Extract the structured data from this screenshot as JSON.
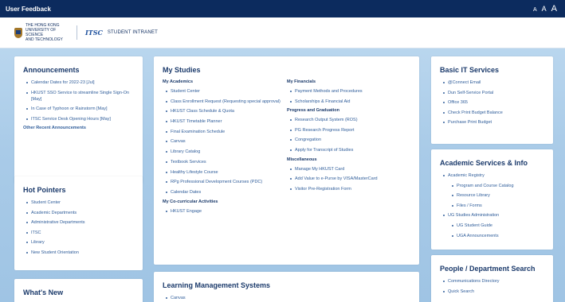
{
  "topbar": {
    "feedback": "User Feedback",
    "font_sizes": [
      "A",
      "A",
      "A"
    ]
  },
  "header": {
    "university_lines": [
      "THE HONG KONG",
      "UNIVERSITY OF SCIENCE",
      "AND TECHNOLOGY"
    ],
    "itsc_logo": "ITSC",
    "portal_name": "STUDENT INTRANET"
  },
  "announcements": {
    "title": "Announcements",
    "items": [
      "Calendar Dates for 2022-23 [Jul]",
      "HKUST SSO Service to streamline Single Sign-On [May]",
      "In Case of Typhoon or Rainstorm [May]",
      "ITSC Service Desk Opening Hours [May]"
    ],
    "other": "Other Recent Announcements"
  },
  "hot_pointers": {
    "title": "Hot Pointers",
    "items": [
      "Student Center",
      "Academic Departments",
      "Administrative Departments",
      "ITSC",
      "Library",
      "New Student Orientation"
    ]
  },
  "whats_new": {
    "title": "What's New"
  },
  "my_studies": {
    "title": "My Studies",
    "academics": {
      "heading": "My Academics",
      "items": [
        "Student Center",
        "Class Enrollment Request (Requesting special approval)",
        "HKUST Class Schedule & Quota",
        "HKUST Timetable Planner",
        "Final Examination Schedule",
        "Canvas",
        "Library Catalog",
        "Textbook Services",
        "Healthy Lifestyle Course",
        "RPg Professional Development Courses (PDC)",
        "Calendar Dates"
      ]
    },
    "cocurricular": {
      "heading": "My Co-curricular Activities",
      "items": [
        "HKUST Engage"
      ]
    },
    "financials": {
      "heading": "My Financials",
      "items": [
        "Payment Methods and Procedures",
        "Scholarships & Financial Aid"
      ]
    },
    "progress": {
      "heading": "Progress and Graduation",
      "items": [
        "Research Output System (ROS)",
        "PG Research Progress Report",
        "Congregation",
        "Apply for Transcript of Studies"
      ]
    },
    "misc": {
      "heading": "Miscellaneous",
      "items": [
        "Manage My HKUST Card",
        "Add Value to e-Purse by VISA/MasterCard",
        "Visitor Pre-Registration Form"
      ]
    }
  },
  "lms": {
    "title": "Learning Management Systems",
    "items": [
      "Canvas"
    ]
  },
  "basic_it": {
    "title": "Basic IT Services",
    "items": [
      "@Connect Email",
      "Dun Self-Service Portal",
      "Office 365",
      "Check Print Budget Balance",
      "Purchase Print Budget"
    ]
  },
  "academic_services": {
    "title": "Academic Services & Info",
    "items": [
      {
        "label": "Academic Registry",
        "sub": false
      },
      {
        "label": "Program and Course Catalog",
        "sub": true
      },
      {
        "label": "Resource Library",
        "sub": true
      },
      {
        "label": "Files / Forms",
        "sub": true
      },
      {
        "label": "UG Studies Administration",
        "sub": false
      },
      {
        "label": "UG Student Guide",
        "sub": true
      },
      {
        "label": "UGA Announcements",
        "sub": true
      }
    ]
  },
  "people_search": {
    "title": "People / Department Search",
    "items": [
      "Communications Directory",
      "Quick Search"
    ]
  }
}
